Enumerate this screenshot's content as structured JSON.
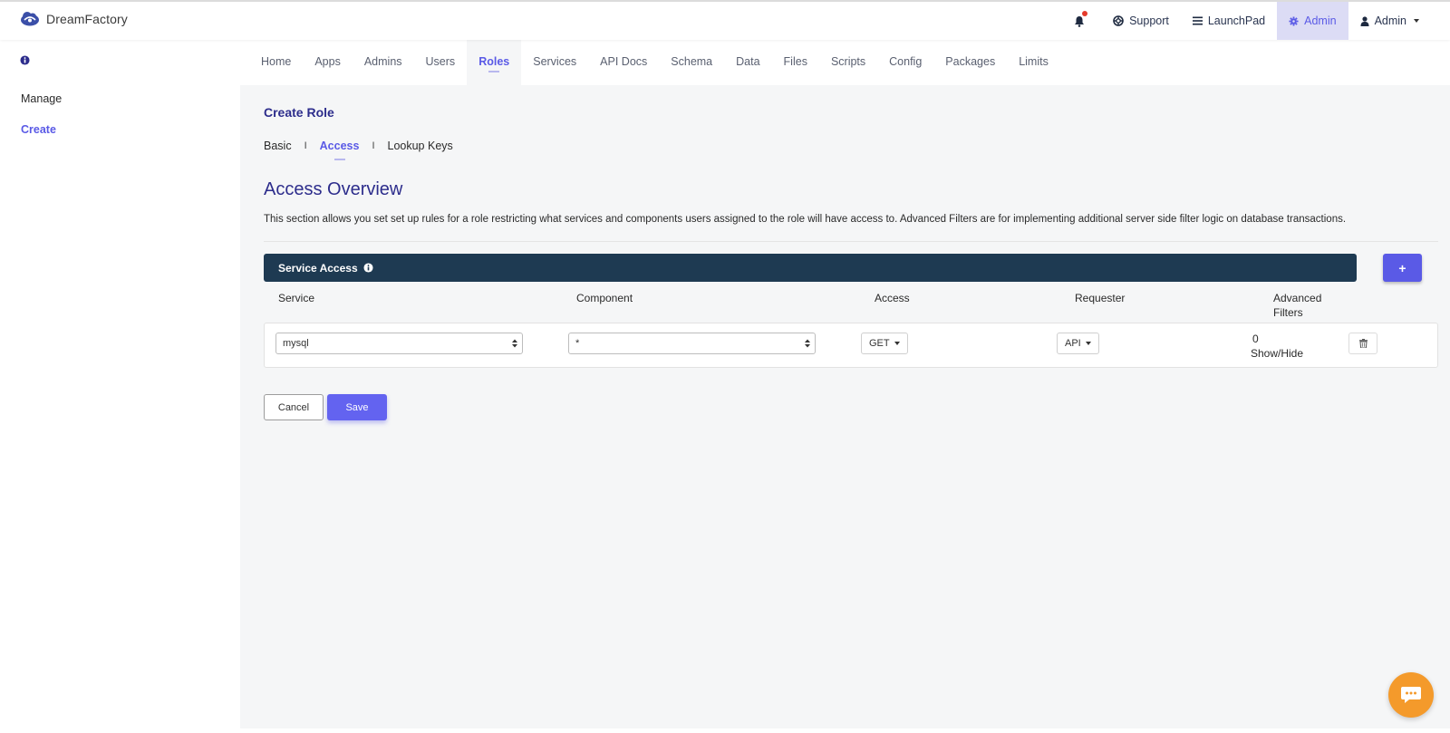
{
  "app": {
    "name": "DreamFactory"
  },
  "topbar": {
    "items": [
      {
        "label": "Support",
        "icon": "lifebuoy-icon"
      },
      {
        "label": "LaunchPad",
        "icon": "bars-icon"
      },
      {
        "label": "Admin",
        "icon": "gear-icon",
        "active": true
      },
      {
        "label": "Admin",
        "icon": "user-icon"
      }
    ],
    "notification_icon": "bell-icon"
  },
  "sidebar": {
    "info_icon": "info-icon",
    "items": [
      {
        "label": "Manage"
      },
      {
        "label": "Create",
        "active": true
      }
    ]
  },
  "nav": {
    "tabs": [
      {
        "label": "Home"
      },
      {
        "label": "Apps"
      },
      {
        "label": "Admins"
      },
      {
        "label": "Users"
      },
      {
        "label": "Roles",
        "active": true
      },
      {
        "label": "Services"
      },
      {
        "label": "API Docs"
      },
      {
        "label": "Schema"
      },
      {
        "label": "Data"
      },
      {
        "label": "Files"
      },
      {
        "label": "Scripts"
      },
      {
        "label": "Config"
      },
      {
        "label": "Packages"
      },
      {
        "label": "Limits"
      }
    ]
  },
  "main": {
    "title": "Create Role",
    "subtabs": [
      {
        "label": "Basic"
      },
      {
        "label": "Access",
        "active": true
      },
      {
        "label": "Lookup Keys"
      }
    ],
    "separator": "I",
    "overview_title": "Access Overview",
    "overview_desc": "This section allows you set set up rules for a role restricting what services and components users assigned to the role will have access to. Advanced Filters are for implementing additional server side filter logic on database transactions.",
    "service_access": {
      "header": "Service Access",
      "add_label": "+",
      "columns": [
        "Service",
        "Component",
        "Access",
        "Requester",
        "Advanced",
        "Filters"
      ],
      "row": {
        "service": "mysql",
        "component": "*",
        "access": "GET",
        "requester": "API",
        "filter_count": "0",
        "filter_toggle": "Show/Hide"
      }
    },
    "actions": {
      "cancel": "Cancel",
      "save": "Save"
    }
  },
  "colors": {
    "accent": "#5a5ae6",
    "header_bar": "#1e3a52",
    "chat": "#f49a2b"
  }
}
